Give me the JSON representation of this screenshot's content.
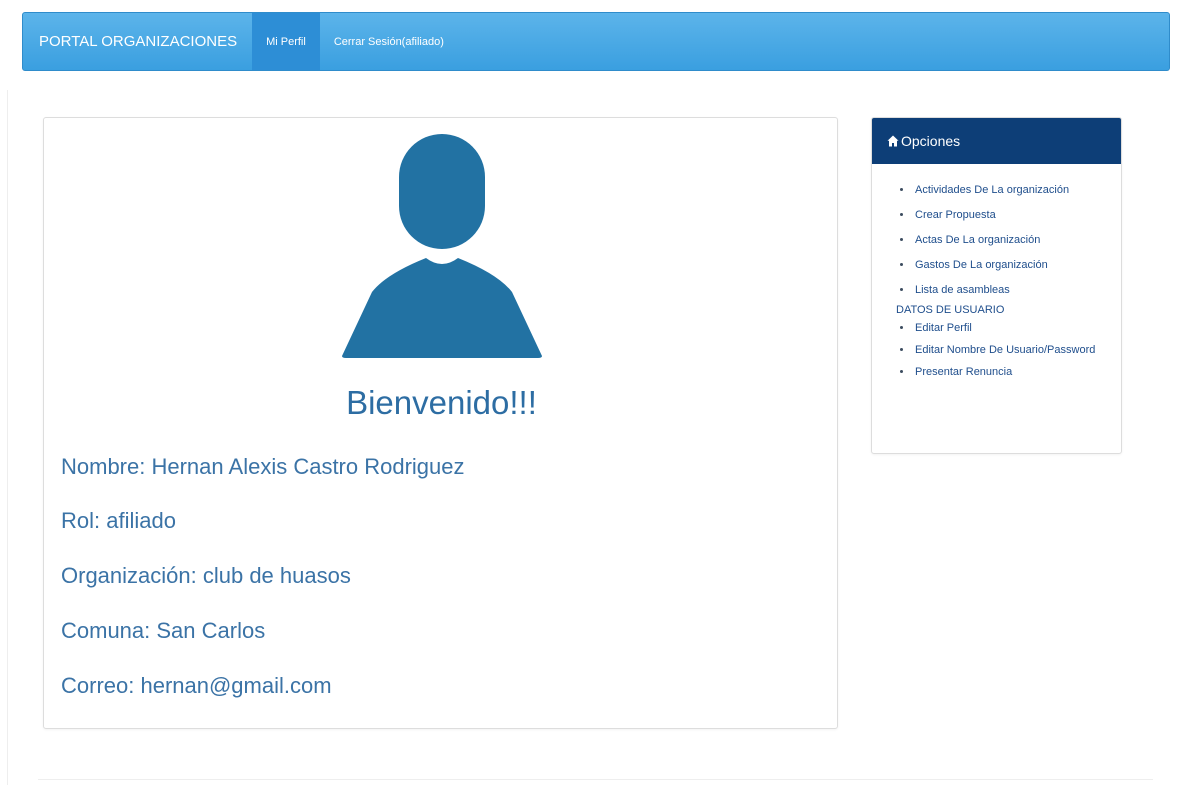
{
  "navbar": {
    "brand": "PORTAL ORGANIZACIONES",
    "items": [
      {
        "label": "Mi Perfil",
        "active": true
      },
      {
        "label": "Cerrar Sesión(afiliado)",
        "active": false
      }
    ],
    "color": "#3a9fe0"
  },
  "profile": {
    "avatar_icon": "user-silhouette-icon",
    "welcome": "Bienvenido!!!",
    "fields": [
      "Nombre: Hernan Alexis Castro Rodriguez",
      "Rol: afiliado",
      "Organización: club de huasos",
      "Comuna: San Carlos",
      "Correo: hernan@gmail.com"
    ],
    "accent": "#2272a3"
  },
  "options": {
    "header_icon": "home-icon",
    "title": "Opciones",
    "header_color": "#0d3e77",
    "items": [
      "Actividades De La organización",
      "Crear Propuesta",
      "Actas De La organización",
      "Gastos De La organización",
      "Lista de asambleas"
    ],
    "user_section": "DATOS DE USUARIO",
    "user_items": [
      "Editar Perfil",
      "Editar Nombre De Usuario/Password",
      "Presentar Renuncia"
    ]
  }
}
